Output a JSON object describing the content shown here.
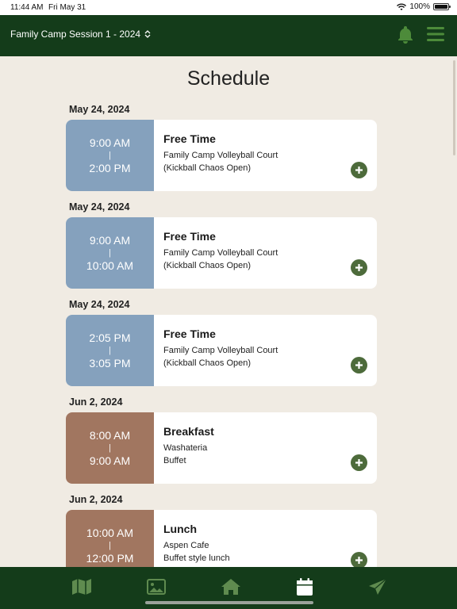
{
  "status_bar": {
    "time": "11:44 AM",
    "date": "Fri May 31",
    "battery": "100%"
  },
  "header": {
    "session_label": "Family Camp Session 1 - 2024"
  },
  "page": {
    "title": "Schedule"
  },
  "colors": {
    "green": "#143c1a",
    "accent": "#4d6b3b",
    "blue_block": "#85a1bd",
    "brown_block": "#a17660",
    "background": "#f0ebe3"
  },
  "schedule": [
    {
      "date": "May 24, 2024",
      "start": "9:00 AM",
      "end": "2:00 PM",
      "title": "Free Time",
      "location": "Family Camp Volleyball Court",
      "note": "(Kickball Chaos Open)",
      "color": "#85a1bd"
    },
    {
      "date": "May 24, 2024",
      "start": "9:00 AM",
      "end": "10:00 AM",
      "title": "Free Time",
      "location": "Family Camp Volleyball Court",
      "note": "(Kickball Chaos Open)",
      "color": "#85a1bd"
    },
    {
      "date": "May 24, 2024",
      "start": "2:05 PM",
      "end": "3:05 PM",
      "title": "Free Time",
      "location": "Family Camp Volleyball Court",
      "note": "(Kickball Chaos Open)",
      "color": "#85a1bd"
    },
    {
      "date": "Jun 2, 2024",
      "start": "8:00 AM",
      "end": "9:00 AM",
      "title": "Breakfast",
      "location": "Washateria",
      "note": "Buffet",
      "color": "#a17660"
    },
    {
      "date": "Jun 2, 2024",
      "start": "10:00 AM",
      "end": "12:00 PM",
      "title": "Lunch",
      "location": "Aspen Cafe",
      "note": "Buffet style lunch",
      "color": "#a17660"
    }
  ],
  "time_separator": "|",
  "tabs": [
    {
      "icon": "map-icon"
    },
    {
      "icon": "image-icon"
    },
    {
      "icon": "home-icon"
    },
    {
      "icon": "calendar-icon"
    },
    {
      "icon": "send-icon"
    }
  ]
}
